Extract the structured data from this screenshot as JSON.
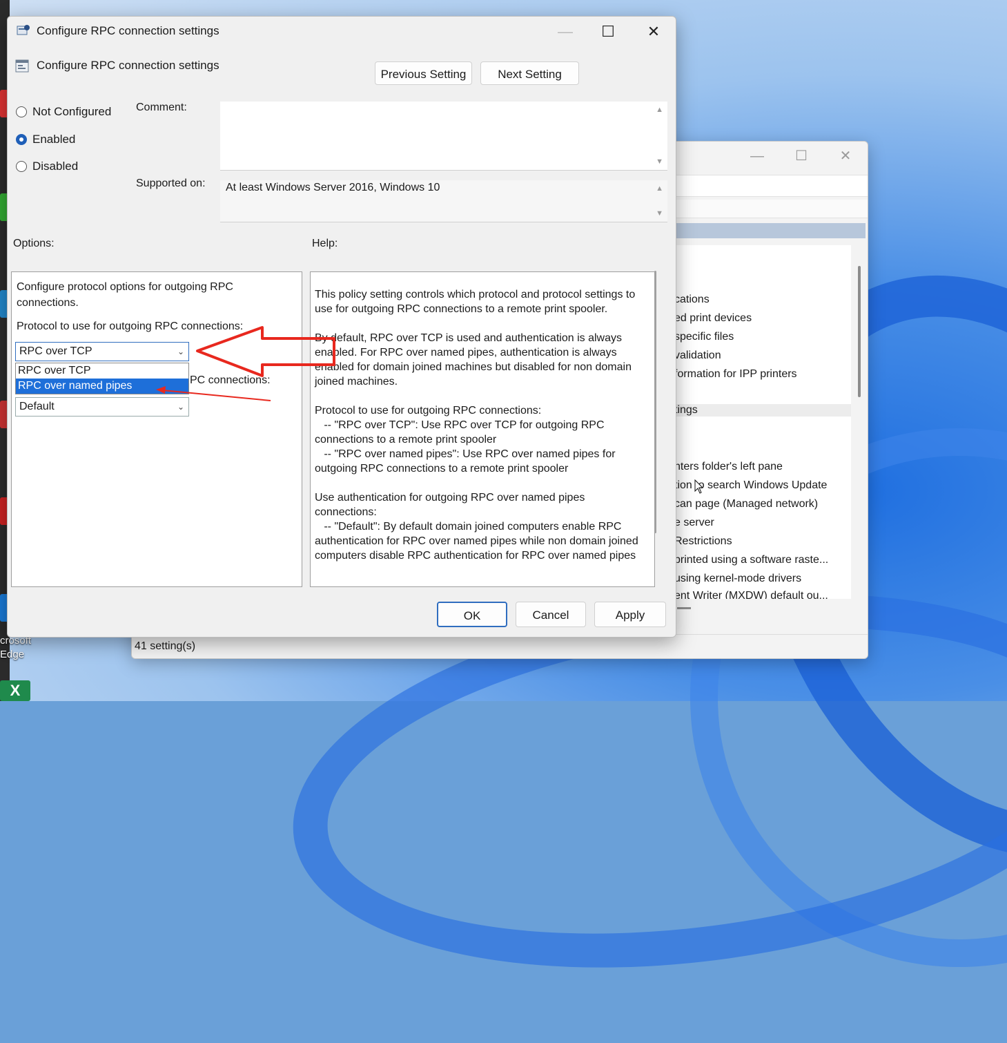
{
  "dialog": {
    "title": "Configure RPC connection settings",
    "policy_title": "Configure RPC connection settings",
    "buttons": {
      "previous": "Previous Setting",
      "next": "Next Setting",
      "ok": "OK",
      "cancel": "Cancel",
      "apply": "Apply"
    },
    "state": {
      "not_configured": "Not Configured",
      "enabled": "Enabled",
      "disabled": "Disabled",
      "selected": "Enabled"
    },
    "comment_label": "Comment:",
    "supported_label": "Supported on:",
    "supported_value": "At least Windows Server 2016, Windows 10",
    "options_label": "Options:",
    "help_label": "Help:"
  },
  "options": {
    "description": "Configure protocol options for outgoing RPC connections.",
    "protocol_label": "Protocol to use for outgoing RPC connections:",
    "protocol_selected": "RPC over TCP",
    "protocol_options": [
      "RPC over TCP",
      "RPC over named pipes"
    ],
    "protocol_highlighted": "RPC over named pipes",
    "auth_label_partial": "PC connections:",
    "auth_selected": "Default"
  },
  "help": {
    "paragraphs": [
      "This policy setting controls which protocol and protocol settings to use for outgoing RPC connections to a remote print spooler.",
      "By default, RPC over TCP is used and authentication is always enabled. For RPC over named pipes, authentication is always enabled for domain joined machines but disabled for non domain joined machines.",
      "Protocol to use for outgoing RPC connections:\n   -- \"RPC over TCP\": Use RPC over TCP for outgoing RPC connections to a remote print spooler\n   -- \"RPC over named pipes\": Use RPC over named pipes for outgoing RPC connections to a remote print spooler",
      "Use authentication for outgoing RPC over named pipes connections:\n   -- \"Default\": By default domain joined computers enable RPC authentication for RPC over named pipes while non domain joined computers disable RPC authentication for RPC over named pipes"
    ]
  },
  "background_window": {
    "list_items": [
      "cations",
      "ed print devices",
      "specific files",
      "validation",
      "formation for IPP printers",
      "tings",
      ";",
      "nters folder's left pane",
      "tion to search Windows Update",
      "can page (Managed network)",
      "e server",
      " Restrictions",
      "printed using a software raste...",
      " using kernel-mode drivers",
      "ent Writer (MXDW) default ou..."
    ],
    "status": "41 setting(s)"
  },
  "desktop": {
    "edge_label": "crosoft\nEdge",
    "excel_glyph": "X"
  },
  "colors": {
    "accent": "#1f5fb8",
    "highlight": "#1e6fd9",
    "annotation_red": "#e8281e"
  }
}
